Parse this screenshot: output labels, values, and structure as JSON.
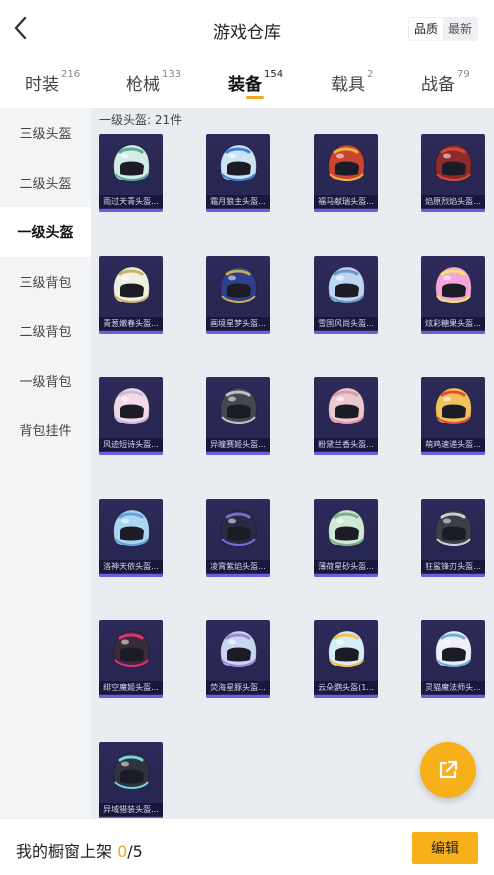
{
  "header": {
    "title": "游戏仓库",
    "sort_options": [
      "品质",
      "最新"
    ],
    "active_sort": "品质"
  },
  "tabs": [
    {
      "label": "时装",
      "count": "216"
    },
    {
      "label": "枪械",
      "count": "133"
    },
    {
      "label": "装备",
      "count": "154",
      "active": true
    },
    {
      "label": "载具",
      "count": "2"
    },
    {
      "label": "战备",
      "count": "79"
    }
  ],
  "sidebar": {
    "items": [
      "三级头盔",
      "二级头盔",
      "一级头盔",
      "三级背包",
      "二级背包",
      "一级背包",
      "背包挂件"
    ],
    "active": "一级头盔"
  },
  "content": {
    "section_label": "一级头盔: 21件",
    "items": [
      {
        "name": "雨过天青头盔...",
        "color": "#d4ece6",
        "accent": "#5aa89a"
      },
      {
        "name": "霜月狼主头盔...",
        "color": "#cfe3f7",
        "accent": "#3d7fd9"
      },
      {
        "name": "福马献瑞头盔...",
        "color": "#c9452f",
        "accent": "#f0b040"
      },
      {
        "name": "焰原烈焰头盔...",
        "color": "#8e2a2a",
        "accent": "#d44a3a"
      },
      {
        "name": "青葱嫩春头盔...",
        "color": "#eef0e2",
        "accent": "#c9b06a"
      },
      {
        "name": "画境星梦头盔...",
        "color": "#2f3f8e",
        "accent": "#c9a850"
      },
      {
        "name": "雪国风尚头盔...",
        "color": "#bcd6f2",
        "accent": "#6f93c9"
      },
      {
        "name": "炫彩糖果头盔...",
        "color": "#f2a6d9",
        "accent": "#f5e26a"
      },
      {
        "name": "风迹短诗头盔...",
        "color": "#f3d9e6",
        "accent": "#c9b9e0"
      },
      {
        "name": "异瞳赛姬头盔...",
        "color": "#45484f",
        "accent": "#b9c3cf"
      },
      {
        "name": "粉黛兰香头盔...",
        "color": "#edc7cf",
        "accent": "#d99aaa"
      },
      {
        "name": "萌鸡速递头盔...",
        "color": "#f2c25a",
        "accent": "#e84a3a"
      },
      {
        "name": "洛神天依头盔...",
        "color": "#a9d6f2",
        "accent": "#6a9fe0"
      },
      {
        "name": "凌霄紫焰头盔...",
        "color": "#2a2a45",
        "accent": "#7a6ad9"
      },
      {
        "name": "薄荷星砂头盔...",
        "color": "#cfe9d6",
        "accent": "#7ab08a"
      },
      {
        "name": "狂鲨锋刃头盔...",
        "color": "#3a3f48",
        "accent": "#c9d0da"
      },
      {
        "name": "绯空魔姬头盔...",
        "color": "#3a2a3a",
        "accent": "#e0307a"
      },
      {
        "name": "荧海星豚头盔...",
        "color": "#c9d6f2",
        "accent": "#9a8ad9"
      },
      {
        "name": "云朵鹦头盔(1...",
        "color": "#d6eef7",
        "accent": "#f5c04a"
      },
      {
        "name": "灵猫魔法师头...",
        "color": "#eef0f5",
        "accent": "#6fb0d9"
      },
      {
        "name": "异域猎装头盔...",
        "color": "#2f3440",
        "accent": "#7ad0e0"
      }
    ]
  },
  "footer": {
    "showcase_prefix": "我的橱窗上架 ",
    "showcase_count": "0",
    "showcase_total": "/5",
    "edit_label": "编辑"
  }
}
